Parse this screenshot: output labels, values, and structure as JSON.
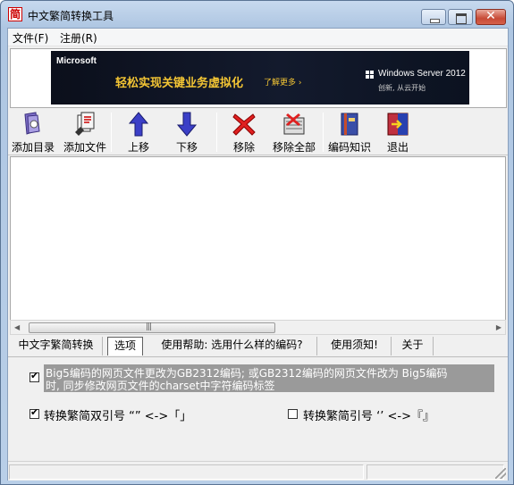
{
  "window": {
    "title": "中文繁简转换工具",
    "app_icon_char": "简"
  },
  "menu": [
    {
      "label": "文件(F)"
    },
    {
      "label": "注册(R)"
    }
  ],
  "ad": {
    "brand": "Microsoft",
    "slogan": "轻松实现关键业务虚拟化",
    "more": "了解更多 ›",
    "product": "Windows Server 2012",
    "sub": "创新, 从云开始",
    "info_icon": "i"
  },
  "toolbar": [
    {
      "label": "添加目录",
      "icon": "folder-add-icon"
    },
    {
      "label": "添加文件",
      "icon": "file-add-icon"
    },
    {
      "label": "上移",
      "icon": "arrow-up-icon"
    },
    {
      "label": "下移",
      "icon": "arrow-down-icon"
    },
    {
      "label": "移除",
      "icon": "red-x-icon"
    },
    {
      "label": "移除全部",
      "icon": "remove-all-icon"
    },
    {
      "label": "编码知识",
      "icon": "book-icon"
    },
    {
      "label": "退出",
      "icon": "exit-icon"
    }
  ],
  "tabs": [
    {
      "label": "中文字繁简转换",
      "active": false
    },
    {
      "label": "选项",
      "active": true
    },
    {
      "label": "使用帮助: 选用什么样的编码?",
      "active": false
    },
    {
      "label": "使用须知!",
      "active": false
    },
    {
      "label": "关于",
      "active": false
    }
  ],
  "options": {
    "opt1_line1": "Big5编码的网页文件更改为GB2312编码; 或GB2312编码的网页文件改为 Big5编码",
    "opt1_line2": "时, 同步修改网页文件的charset中字符编码标签",
    "opt1_checked": true,
    "opt2_label": "转换繁简双引号  “”  <->「」",
    "opt2_checked": true,
    "opt3_label": "转换繁简引号  ‘’  <->『』",
    "opt3_checked": false
  },
  "scrollbar": {
    "grip": "|||"
  },
  "colors": {
    "accent_red": "#cc2020",
    "arrow_blue": "#3b3fc7",
    "ad_yellow": "#f3c534"
  }
}
